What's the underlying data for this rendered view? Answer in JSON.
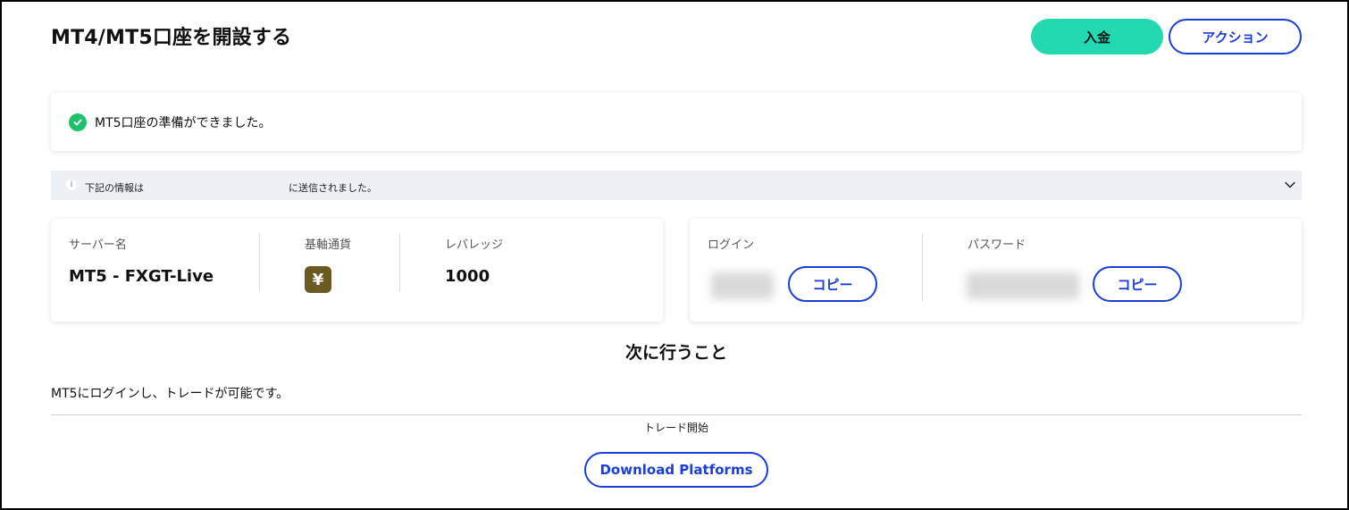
{
  "header": {
    "title": "MT4/MT5口座を開設する",
    "deposit_label": "入金",
    "action_label": "アクション"
  },
  "status": {
    "message": "MT5口座の準備ができました。",
    "icon": "check-circle-icon"
  },
  "info_bar": {
    "text_before": "下記の情報は",
    "text_after": "に送信されました。",
    "icon": "info-icon",
    "toggle_icon": "chevron-down-icon"
  },
  "account": {
    "server_label": "サーバー名",
    "server_value": "MT5 - FXGT-Live",
    "currency_label": "基軸通貨",
    "currency_symbol": "¥",
    "leverage_label": "レバレッジ",
    "leverage_value": "1000"
  },
  "credentials": {
    "login_label": "ログイン",
    "password_label": "パスワード",
    "copy_label": "コピー"
  },
  "next_steps": {
    "heading": "次に行うこと",
    "description": "MT5にログインし、トレードが可能です。",
    "trade_start_label": "トレード開始",
    "download_label": "Download Platforms"
  },
  "colors": {
    "accent": "#1a3ed6",
    "deposit": "#23dab0",
    "success": "#1fc26b",
    "currency_badge": "#6b5a22"
  }
}
